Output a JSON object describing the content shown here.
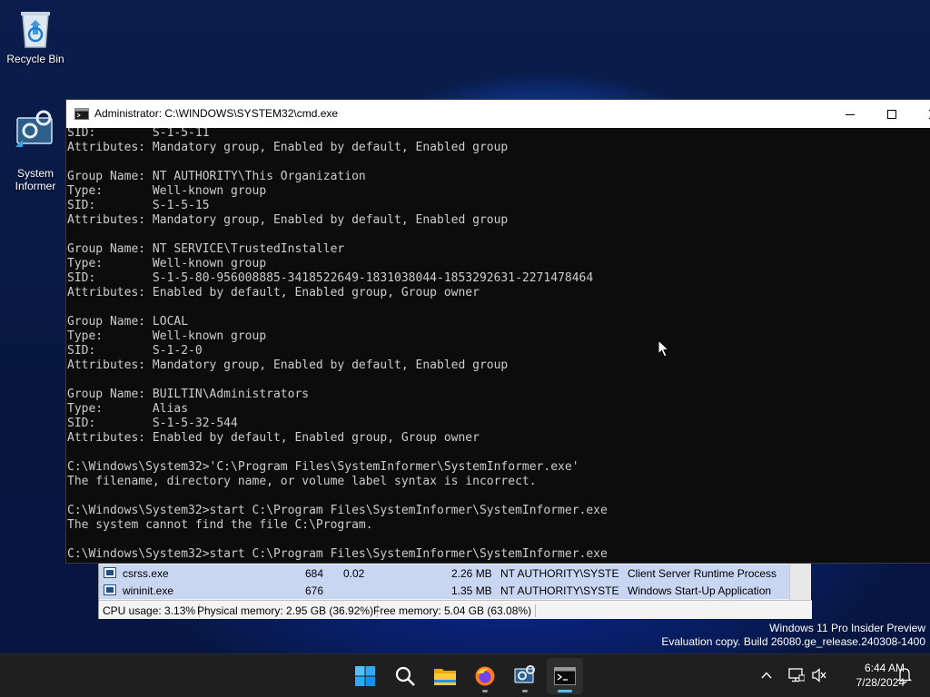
{
  "desktop": {
    "icons": [
      {
        "label": "Recycle Bin",
        "icon": "recycle-bin-icon"
      },
      {
        "label": "System\nInformer",
        "icon": "system-informer-icon"
      }
    ],
    "watermark": {
      "line1": "Windows 11 Pro Insider Preview",
      "line2": "Evaluation copy. Build 26080.ge_release.240308-1400"
    }
  },
  "cmd_window": {
    "title": "Administrator: C:\\WINDOWS\\SYSTEM32\\cmd.exe",
    "controls": {
      "minimize": "minimize-icon",
      "maximize": "maximize-icon",
      "close": "close-icon"
    },
    "lines": [
      "SID:        S-1-5-11",
      "Attributes: Mandatory group, Enabled by default, Enabled group",
      "",
      "Group Name: NT AUTHORITY\\This Organization",
      "Type:       Well-known group",
      "SID:        S-1-5-15",
      "Attributes: Mandatory group, Enabled by default, Enabled group",
      "",
      "Group Name: NT SERVICE\\TrustedInstaller",
      "Type:       Well-known group",
      "SID:        S-1-5-80-956008885-3418522649-1831038044-1853292631-2271478464",
      "Attributes: Enabled by default, Enabled group, Group owner",
      "",
      "Group Name: LOCAL",
      "Type:       Well-known group",
      "SID:        S-1-2-0",
      "Attributes: Mandatory group, Enabled by default, Enabled group",
      "",
      "Group Name: BUILTIN\\Administrators",
      "Type:       Alias",
      "SID:        S-1-5-32-544",
      "Attributes: Enabled by default, Enabled group, Group owner",
      "",
      "C:\\Windows\\System32>'C:\\Program Files\\SystemInformer\\SystemInformer.exe'",
      "The filename, directory name, or volume label syntax is incorrect.",
      "",
      "C:\\Windows\\System32>start C:\\Program Files\\SystemInformer\\SystemInformer.exe",
      "The system cannot find the file C:\\Program.",
      "",
      "C:\\Windows\\System32>start C:\\Program Files\\SystemInformer\\SystemInformer.exe"
    ]
  },
  "system_informer": {
    "rows": [
      {
        "name": "csrss.exe",
        "pid": "684",
        "cpu": "0.02",
        "memory": "2.26 MB",
        "user": "NT AUTHORITY\\SYSTEM",
        "description": "Client Server Runtime Process"
      },
      {
        "name": "wininit.exe",
        "pid": "676",
        "cpu": "",
        "memory": "1.35 MB",
        "user": "NT AUTHORITY\\SYSTEM",
        "description": "Windows Start-Up Application"
      }
    ],
    "status": {
      "cpu": "CPU usage: 3.13%",
      "physical": "Physical memory: 2.95 GB (36.92%)",
      "free": "Free memory: 5.04 GB (63.08%)"
    }
  },
  "taskbar": {
    "apps": [
      {
        "name": "start",
        "icon": "windows-start-icon"
      },
      {
        "name": "search",
        "icon": "search-icon"
      },
      {
        "name": "file-explorer",
        "icon": "folder-icon"
      },
      {
        "name": "firefox",
        "icon": "firefox-icon"
      },
      {
        "name": "system-informer",
        "icon": "system-informer-icon"
      },
      {
        "name": "command-prompt",
        "icon": "terminal-icon"
      }
    ],
    "tray": {
      "time": "6:44 AM",
      "date": "7/28/2024"
    }
  }
}
